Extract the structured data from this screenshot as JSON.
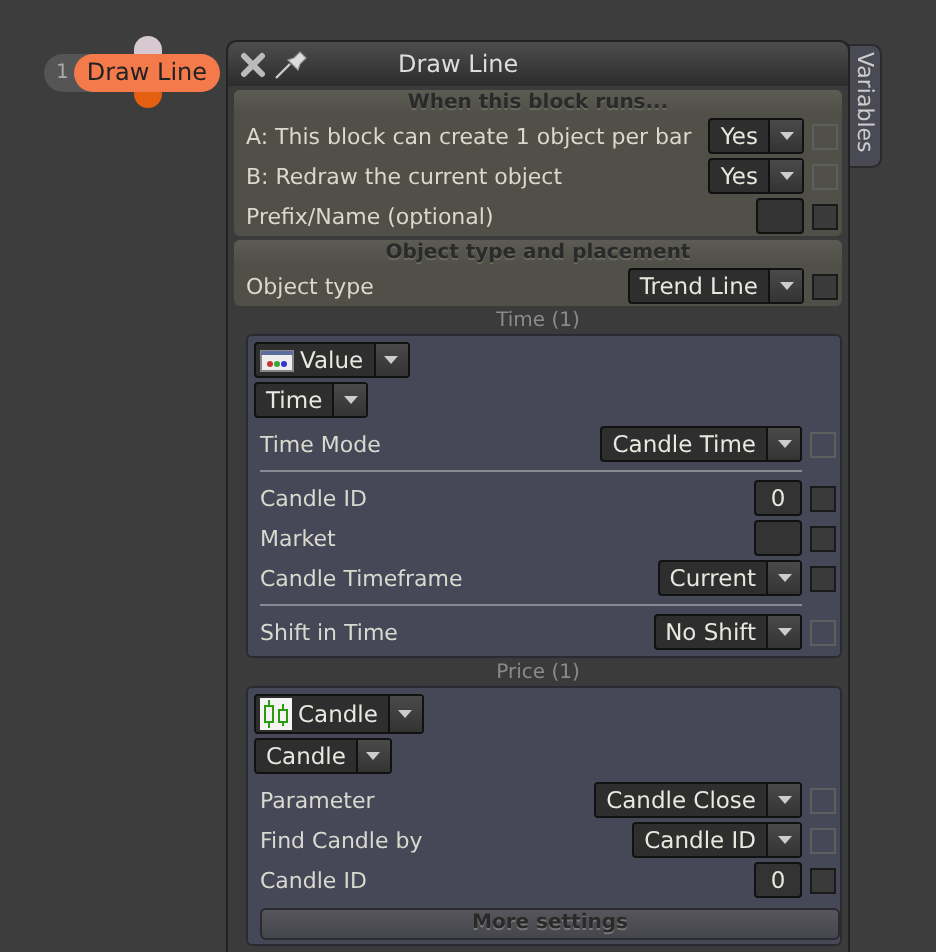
{
  "node": {
    "number": "1",
    "label": "Draw Line"
  },
  "window": {
    "title": "Draw Line",
    "side_tab": "Variables"
  },
  "sections": [
    {
      "title": "When this block runs...",
      "rows": [
        {
          "kind": "dropdown",
          "label": "A: This block can create 1 object per bar",
          "value": "Yes",
          "checkbox_disabled": true
        },
        {
          "kind": "dropdown",
          "label": "B: Redraw the current object",
          "value": "Yes",
          "checkbox_disabled": true
        },
        {
          "kind": "input",
          "label": "Prefix/Name (optional)",
          "checkbox_disabled": false
        }
      ]
    },
    {
      "title": "Object type and placement",
      "rows": [
        {
          "kind": "dropdown",
          "label": "Object type",
          "value": "Trend Line",
          "checkbox_disabled": false
        }
      ]
    }
  ],
  "groups": [
    {
      "title": "Time (1)",
      "kind": "value",
      "source": "Value",
      "subtype": "Time",
      "rows": [
        {
          "kind": "dropdown",
          "label": "Time Mode",
          "value": "Candle Time",
          "checkbox_disabled": true
        },
        {
          "kind": "divider"
        },
        {
          "kind": "input",
          "label": "Candle ID",
          "value": "0",
          "checkbox_disabled": false
        },
        {
          "kind": "input",
          "label": "Market",
          "checkbox_disabled": false
        },
        {
          "kind": "dropdown",
          "label": "Candle Timeframe",
          "value": "Current",
          "checkbox_disabled": false
        },
        {
          "kind": "divider"
        },
        {
          "kind": "dropdown",
          "label": "Shift in Time",
          "value": "No Shift",
          "checkbox_disabled": true
        }
      ]
    },
    {
      "title": "Price (1)",
      "kind": "candle",
      "source": "Candle",
      "subtype": "Candle",
      "rows": [
        {
          "kind": "dropdown",
          "label": "Parameter",
          "value": "Candle Close",
          "checkbox_disabled": true
        },
        {
          "kind": "dropdown",
          "label": "Find Candle by",
          "value": "Candle ID",
          "checkbox_disabled": true
        },
        {
          "kind": "input",
          "label": "Candle ID",
          "value": "0",
          "checkbox_disabled": false
        }
      ],
      "more_settings": "More settings"
    }
  ]
}
